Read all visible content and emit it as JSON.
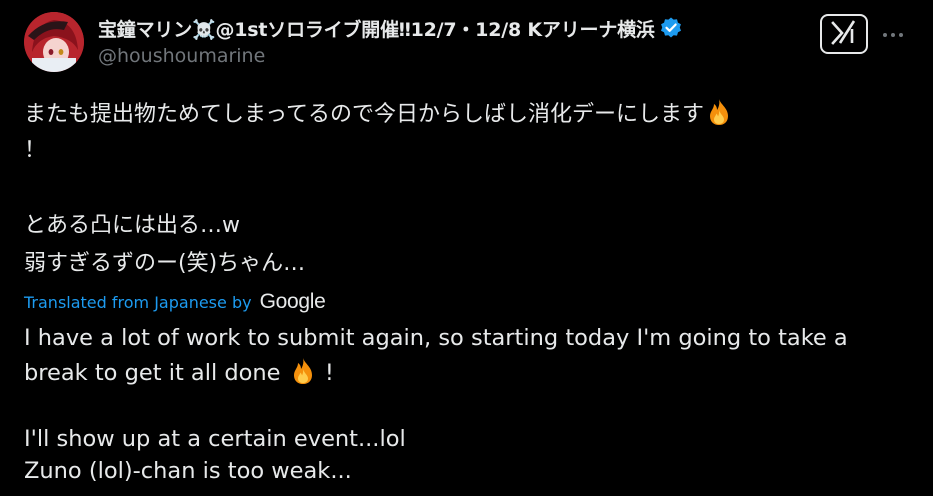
{
  "user": {
    "display_name": "宝鐘マリン☠️@1stソロライブ開催‼12/7・12/8 Kアリーナ横浜",
    "handle": "@houshoumarine"
  },
  "icons": {
    "verified": "verified-badge-icon",
    "grok": "grok-icon",
    "more": "more-options-icon",
    "fire": "fire-emoji-icon"
  },
  "colors": {
    "background": "#000000",
    "text": "#e7e9ea",
    "secondary": "#71767b",
    "accent": "#1d9bf0"
  },
  "post": {
    "original_lines": [
      "またも提出物ためてしまってるので今日からしばし消化デーにします",
      "！",
      "とある凸には出る…w",
      "弱すぎるずのー(笑)ちゃん…"
    ],
    "translation_label": "Translated from Japanese by",
    "translation_provider": "Google",
    "translated_lines": [
      "I have a lot of work to submit again, so starting today I'm going to take a",
      "break to get it all done",
      "!",
      "I'll show up at a certain event...lol",
      "Zuno (lol)-chan is too weak..."
    ]
  }
}
